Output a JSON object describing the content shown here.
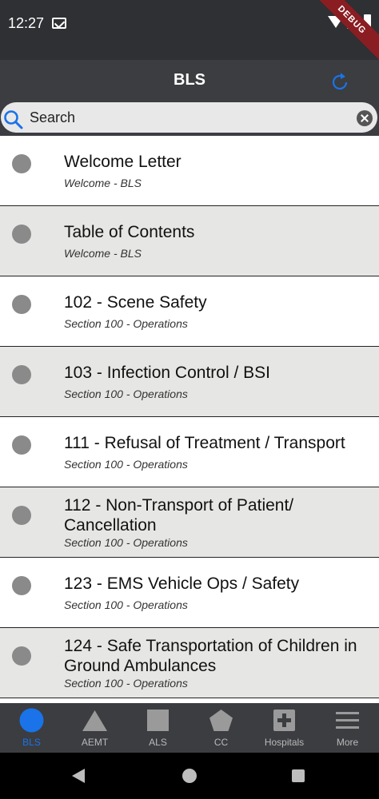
{
  "status_bar": {
    "time": "12:27",
    "debug_label": "DEBUG"
  },
  "app_bar": {
    "title": "BLS"
  },
  "search": {
    "placeholder": "Search"
  },
  "list": {
    "items": [
      {
        "title": "Welcome Letter",
        "subtitle": "Welcome - BLS"
      },
      {
        "title": "Table of Contents",
        "subtitle": "Welcome - BLS"
      },
      {
        "title": "102 - Scene Safety",
        "subtitle": "Section 100 - Operations"
      },
      {
        "title": "103 - Infection Control / BSI",
        "subtitle": "Section 100 - Operations"
      },
      {
        "title": "111 - Refusal of Treatment / Transport",
        "subtitle": "Section 100 - Operations"
      },
      {
        "title": "112 - Non-Transport of Patient/ Cancellation",
        "subtitle": "Section 100 - Operations"
      },
      {
        "title": "123 - EMS Vehicle Ops / Safety",
        "subtitle": "Section 100 - Operations"
      },
      {
        "title": "124 - Safe Transportation of Children in Ground Ambulances",
        "subtitle": "Section 100 - Operations"
      }
    ]
  },
  "bottom_nav": {
    "items": [
      {
        "label": "BLS",
        "icon": "circle-icon",
        "active": true
      },
      {
        "label": "AEMT",
        "icon": "triangle-icon",
        "active": false
      },
      {
        "label": "ALS",
        "icon": "square-icon",
        "active": false
      },
      {
        "label": "CC",
        "icon": "pentagon-icon",
        "active": false
      },
      {
        "label": "Hospitals",
        "icon": "hospital-cross-icon",
        "active": false
      },
      {
        "label": "More",
        "icon": "menu-icon",
        "active": false
      }
    ]
  },
  "colors": {
    "accent": "#1a73e8",
    "nav_inactive": "#b9b9b9",
    "app_bar": "#3b3d41",
    "debug_banner": "#8a1d22"
  }
}
